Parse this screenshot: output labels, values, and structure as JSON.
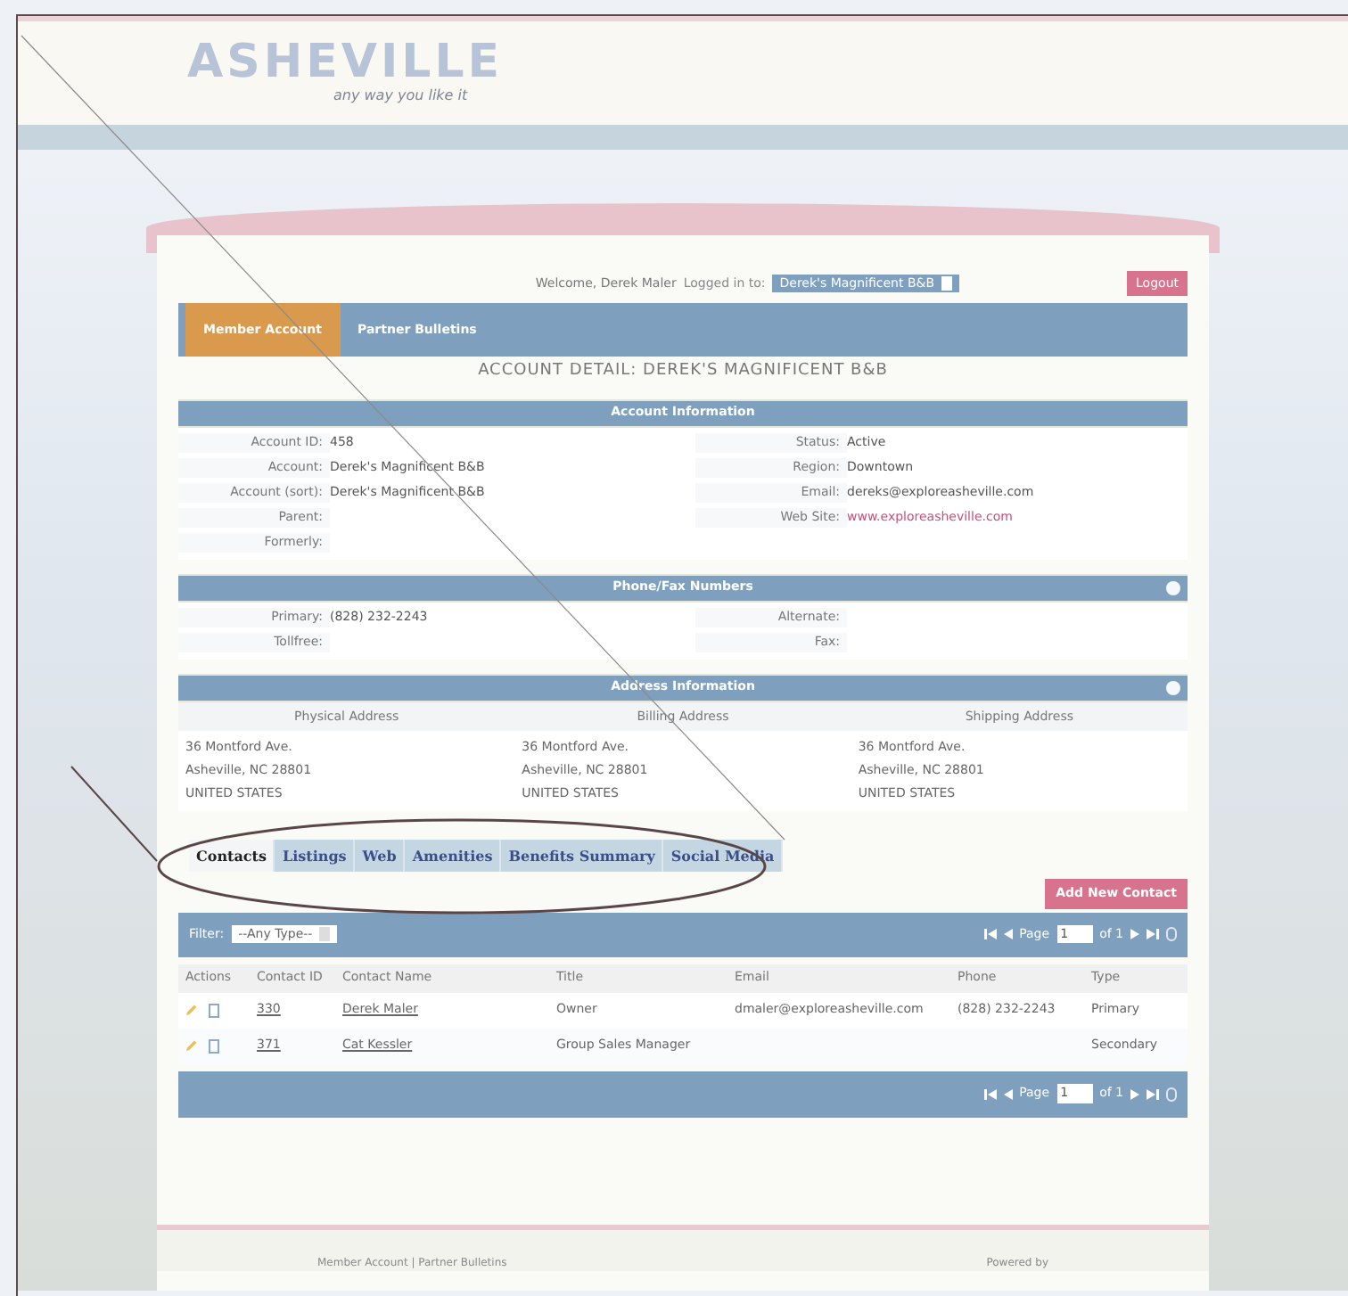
{
  "header": {
    "logo": "ASHEVILLE",
    "tagline": "any way you like it"
  },
  "userbar": {
    "welcome": "Welcome, Derek Maler",
    "logged_in_label": "Logged in to:",
    "account_select": "Derek's Magnificent B&B",
    "logout": "Logout"
  },
  "nav_tabs": [
    {
      "label": "Member Account",
      "selected": true
    },
    {
      "label": "Partner Bulletins",
      "selected": false
    }
  ],
  "page_title": "ACCOUNT DETAIL: DEREK'S MAGNIFICENT B&B",
  "account_info": {
    "title": "Account Information",
    "left": [
      {
        "label": "Account ID:",
        "value": "458"
      },
      {
        "label": "Account:",
        "value": "Derek's Magnificent B&B"
      },
      {
        "label": "Account (sort):",
        "value": "Derek's Magnificent B&B"
      },
      {
        "label": "Parent:"
      },
      {
        "label": "Formerly:"
      }
    ],
    "right": [
      {
        "label": "Status:",
        "value": "Active",
        "kind": "text"
      },
      {
        "label": "Region:",
        "value": "Downtown",
        "kind": "text"
      },
      {
        "label": "Email:",
        "value": "dereks@exploreasheville.com",
        "kind": "text"
      },
      {
        "label": "Web Site:",
        "value": "www.exploreasheville.com",
        "kind": "link"
      }
    ]
  },
  "phone_info": {
    "title": "Phone/Fax Numbers",
    "left": [
      {
        "label": "Primary:",
        "value": "(828) 232-2243"
      },
      {
        "label": "Tollfree:"
      }
    ],
    "right": [
      {
        "label": "Alternate:"
      },
      {
        "label": "Fax:"
      }
    ]
  },
  "address_info": {
    "title": "Address Information",
    "columns": [
      {
        "heading": "Physical Address",
        "lines": [
          "36 Montford Ave.",
          "Asheville, NC 28801",
          "UNITED STATES"
        ]
      },
      {
        "heading": "Billing Address",
        "lines": [
          "36 Montford Ave.",
          "Asheville, NC 28801",
          "UNITED STATES"
        ]
      },
      {
        "heading": "Shipping Address",
        "lines": [
          "36 Montford Ave.",
          "Asheville, NC 28801",
          "UNITED STATES"
        ]
      }
    ]
  },
  "detail_tabs": [
    {
      "label": "Contacts",
      "selected": true
    },
    {
      "label": "Listings",
      "selected": false
    },
    {
      "label": "Web",
      "selected": false
    },
    {
      "label": "Amenities",
      "selected": false
    },
    {
      "label": "Benefits Summary",
      "selected": false
    },
    {
      "label": "Social Media",
      "selected": false
    }
  ],
  "add_button": "Add New Contact",
  "filter": {
    "label": "Filter:",
    "value": "--Any Type--"
  },
  "pagers": [
    {
      "page_label": "Page",
      "page": "1",
      "of": "of 1"
    },
    {
      "page_label": "Page",
      "page": "1",
      "of": "of 1"
    }
  ],
  "table": {
    "columns": [
      "Actions",
      "Contact ID",
      "Contact Name",
      "Title",
      "Email",
      "Phone",
      "Type"
    ],
    "rows": [
      {
        "id": "330",
        "name": "Derek Maler",
        "title": "Owner",
        "email": "dmaler@exploreasheville.com",
        "phone": "(828) 232-2243",
        "type": "Primary"
      },
      {
        "id": "371",
        "name": "Cat Kessler",
        "title": "Group Sales Manager",
        "email": "",
        "phone": "",
        "type": "Secondary"
      }
    ]
  },
  "footer": {
    "links": "Member Account | Partner Bulletins",
    "powered": "Powered by"
  }
}
